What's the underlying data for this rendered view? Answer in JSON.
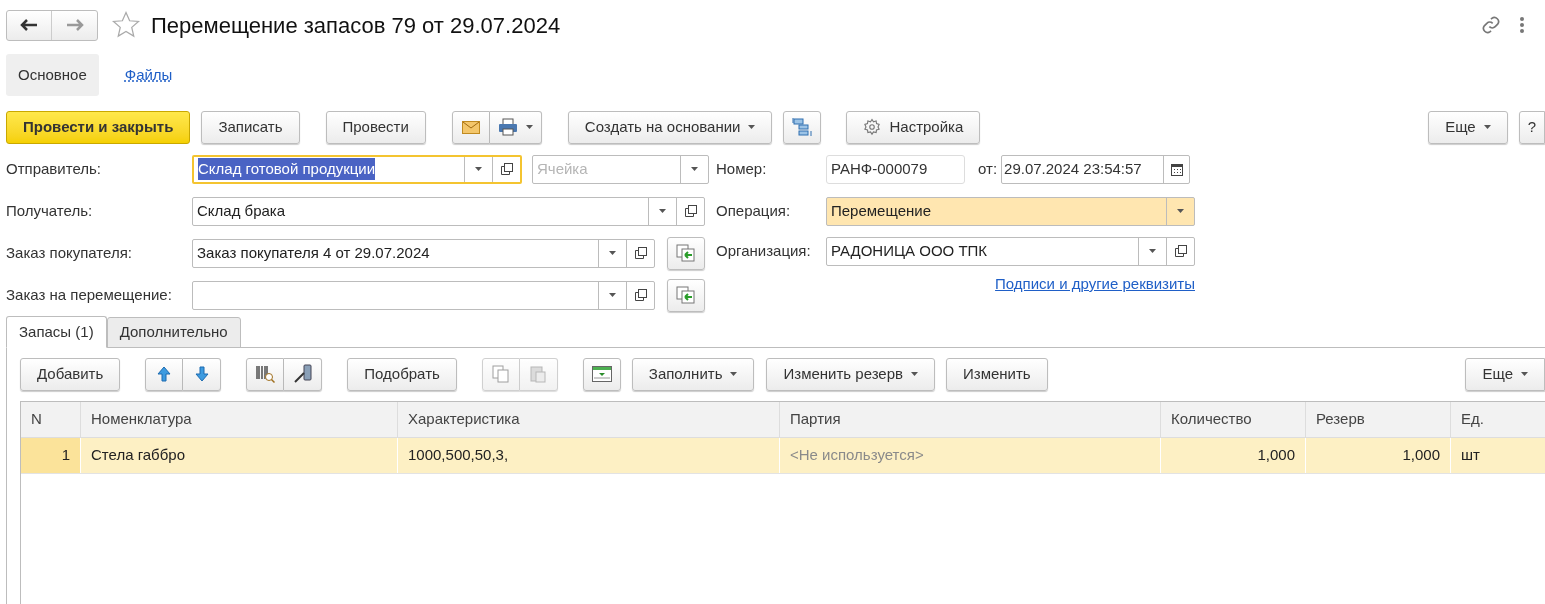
{
  "title": "Перемещение запасов 79 от 29.07.2024",
  "favorite": false,
  "sections": [
    {
      "label": "Основное",
      "selected": true
    },
    {
      "label": "Файлы",
      "selected": false
    }
  ],
  "commands": [
    {
      "kind": "primary",
      "label": "Провести и закрыть"
    },
    {
      "kind": "plain",
      "label": "Записать"
    },
    {
      "kind": "plain",
      "label": "Провести"
    },
    {
      "kind": "mail-print"
    },
    {
      "kind": "dropdown",
      "label": "Создать на основании"
    },
    {
      "kind": "structure"
    },
    {
      "kind": "settings",
      "label": "Настройка"
    }
  ],
  "more_label": "Еще",
  "help_label": "?",
  "left_fields": [
    {
      "label": "Отправитель:",
      "value": "Склад готовой продукции",
      "focused": true,
      "cell_placeholder": "Ячейка"
    },
    {
      "label": "Получатель:",
      "value": "Склад брака",
      "focused": false
    },
    {
      "label": "Заказ покупателя:",
      "value": "Заказ покупателя 4 от 29.07.2024",
      "focused": false,
      "fill_button": true
    },
    {
      "label": "Заказ на перемещение:",
      "focused": false,
      "fill_button": true
    }
  ],
  "number": {
    "label": "Номер:",
    "value": "РАНФ-000079",
    "date_label": "от:",
    "date": "29.07.2024 23:54:57"
  },
  "operation": {
    "label": "Операция:",
    "value": "Перемещение"
  },
  "organization": {
    "label": "Организация:",
    "value": "РАДОНИЦА ООО ТПК"
  },
  "details_link": "Подписи и другие реквизиты",
  "tabs": [
    {
      "label": "Запасы (1)",
      "selected": true
    },
    {
      "label": "Дополнительно",
      "selected": false
    }
  ],
  "table_toolbar": {
    "add": "Добавить",
    "pick": "Подобрать",
    "fill": "Заполнить",
    "change_reserve": "Изменить резерв",
    "change": "Изменить",
    "more": "Еще"
  },
  "table": {
    "columns": [
      "N",
      "Номенклатура",
      "Характеристика",
      "Партия",
      "Количество",
      "Резерв",
      "Ед."
    ],
    "rows": [
      {
        "selected": true,
        "cells": [
          "1",
          "Стела габбро",
          "1000,500,50,3,",
          "<Не используется>",
          "1,000",
          "1,000",
          "шт"
        ]
      }
    ]
  }
}
